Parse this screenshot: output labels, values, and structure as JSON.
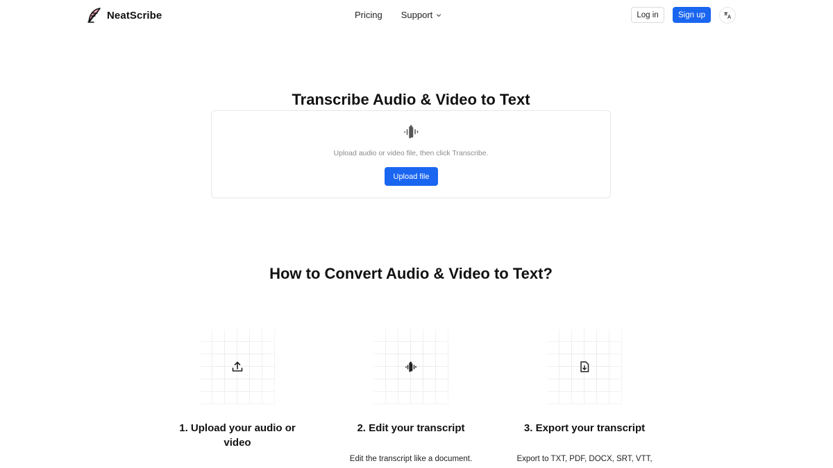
{
  "header": {
    "brand": "NeatScribe",
    "nav": {
      "pricing": "Pricing",
      "support": "Support"
    },
    "login": "Log in",
    "signup": "Sign up"
  },
  "hero": {
    "title": "Transcribe Audio & Video to Text",
    "hint": "Upload audio or video file, then click Transcribe.",
    "upload_button": "Upload file"
  },
  "howto": {
    "title": "How to Convert Audio & Video to Text?",
    "steps": [
      {
        "title": "1. Upload your audio or video",
        "desc": "",
        "icon": "upload-icon"
      },
      {
        "title": "2. Edit your transcript",
        "desc": "Edit the transcript like a document.",
        "icon": "waveform-icon"
      },
      {
        "title": "3. Export your transcript",
        "desc": "Export to TXT, PDF, DOCX, SRT, VTT,",
        "icon": "file-download-icon"
      }
    ]
  },
  "colors": {
    "accent": "#1a66f0",
    "text": "#111111",
    "muted": "#8a8a8a",
    "border": "#e7e7e7"
  }
}
